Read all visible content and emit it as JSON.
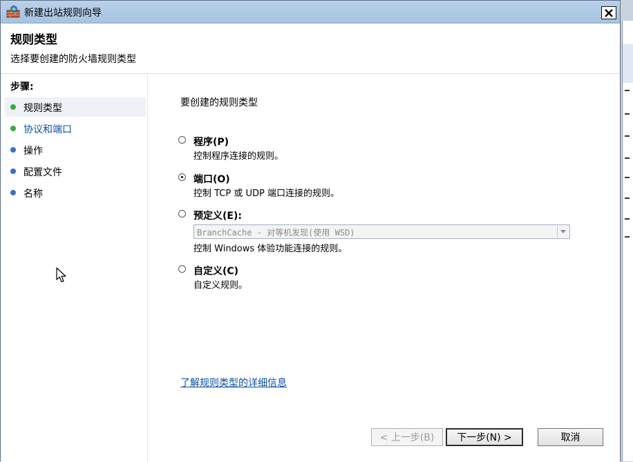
{
  "window": {
    "title": "新建出站规则向导"
  },
  "header": {
    "title": "规则类型",
    "subtitle": "选择要创建的防火墙规则类型"
  },
  "sidebar": {
    "title": "步骤:",
    "items": [
      {
        "label": "规则类型",
        "color": "#3aa83a"
      },
      {
        "label": "协议和端口",
        "color": "#3aa83a"
      },
      {
        "label": "操作",
        "color": "#3d6fc4"
      },
      {
        "label": "配置文件",
        "color": "#3d6fc4"
      },
      {
        "label": "名称",
        "color": "#3d6fc4"
      }
    ]
  },
  "content": {
    "intro": "要创建的规则类型",
    "options": [
      {
        "label": "程序(P)",
        "desc": "控制程序连接的规则。",
        "selected": false
      },
      {
        "label": "端口(O)",
        "desc": "控制 TCP 或 UDP 端口连接的规则。",
        "selected": true
      },
      {
        "label": "预定义(E):",
        "desc": "控制 Windows 体验功能连接的规则。",
        "selected": false
      },
      {
        "label": "自定义(C)",
        "desc": "自定义规则。",
        "selected": false
      }
    ],
    "predefined_select": "BranchCache - 对等机发现(使用 WSD)",
    "link": "了解规则类型的详细信息"
  },
  "buttons": {
    "back": "< 上一步(B)",
    "next": "下一步(N) >",
    "cancel": "取消"
  },
  "colors": {
    "titlebar": "#b9d1ea",
    "link": "#0b4fa8"
  }
}
